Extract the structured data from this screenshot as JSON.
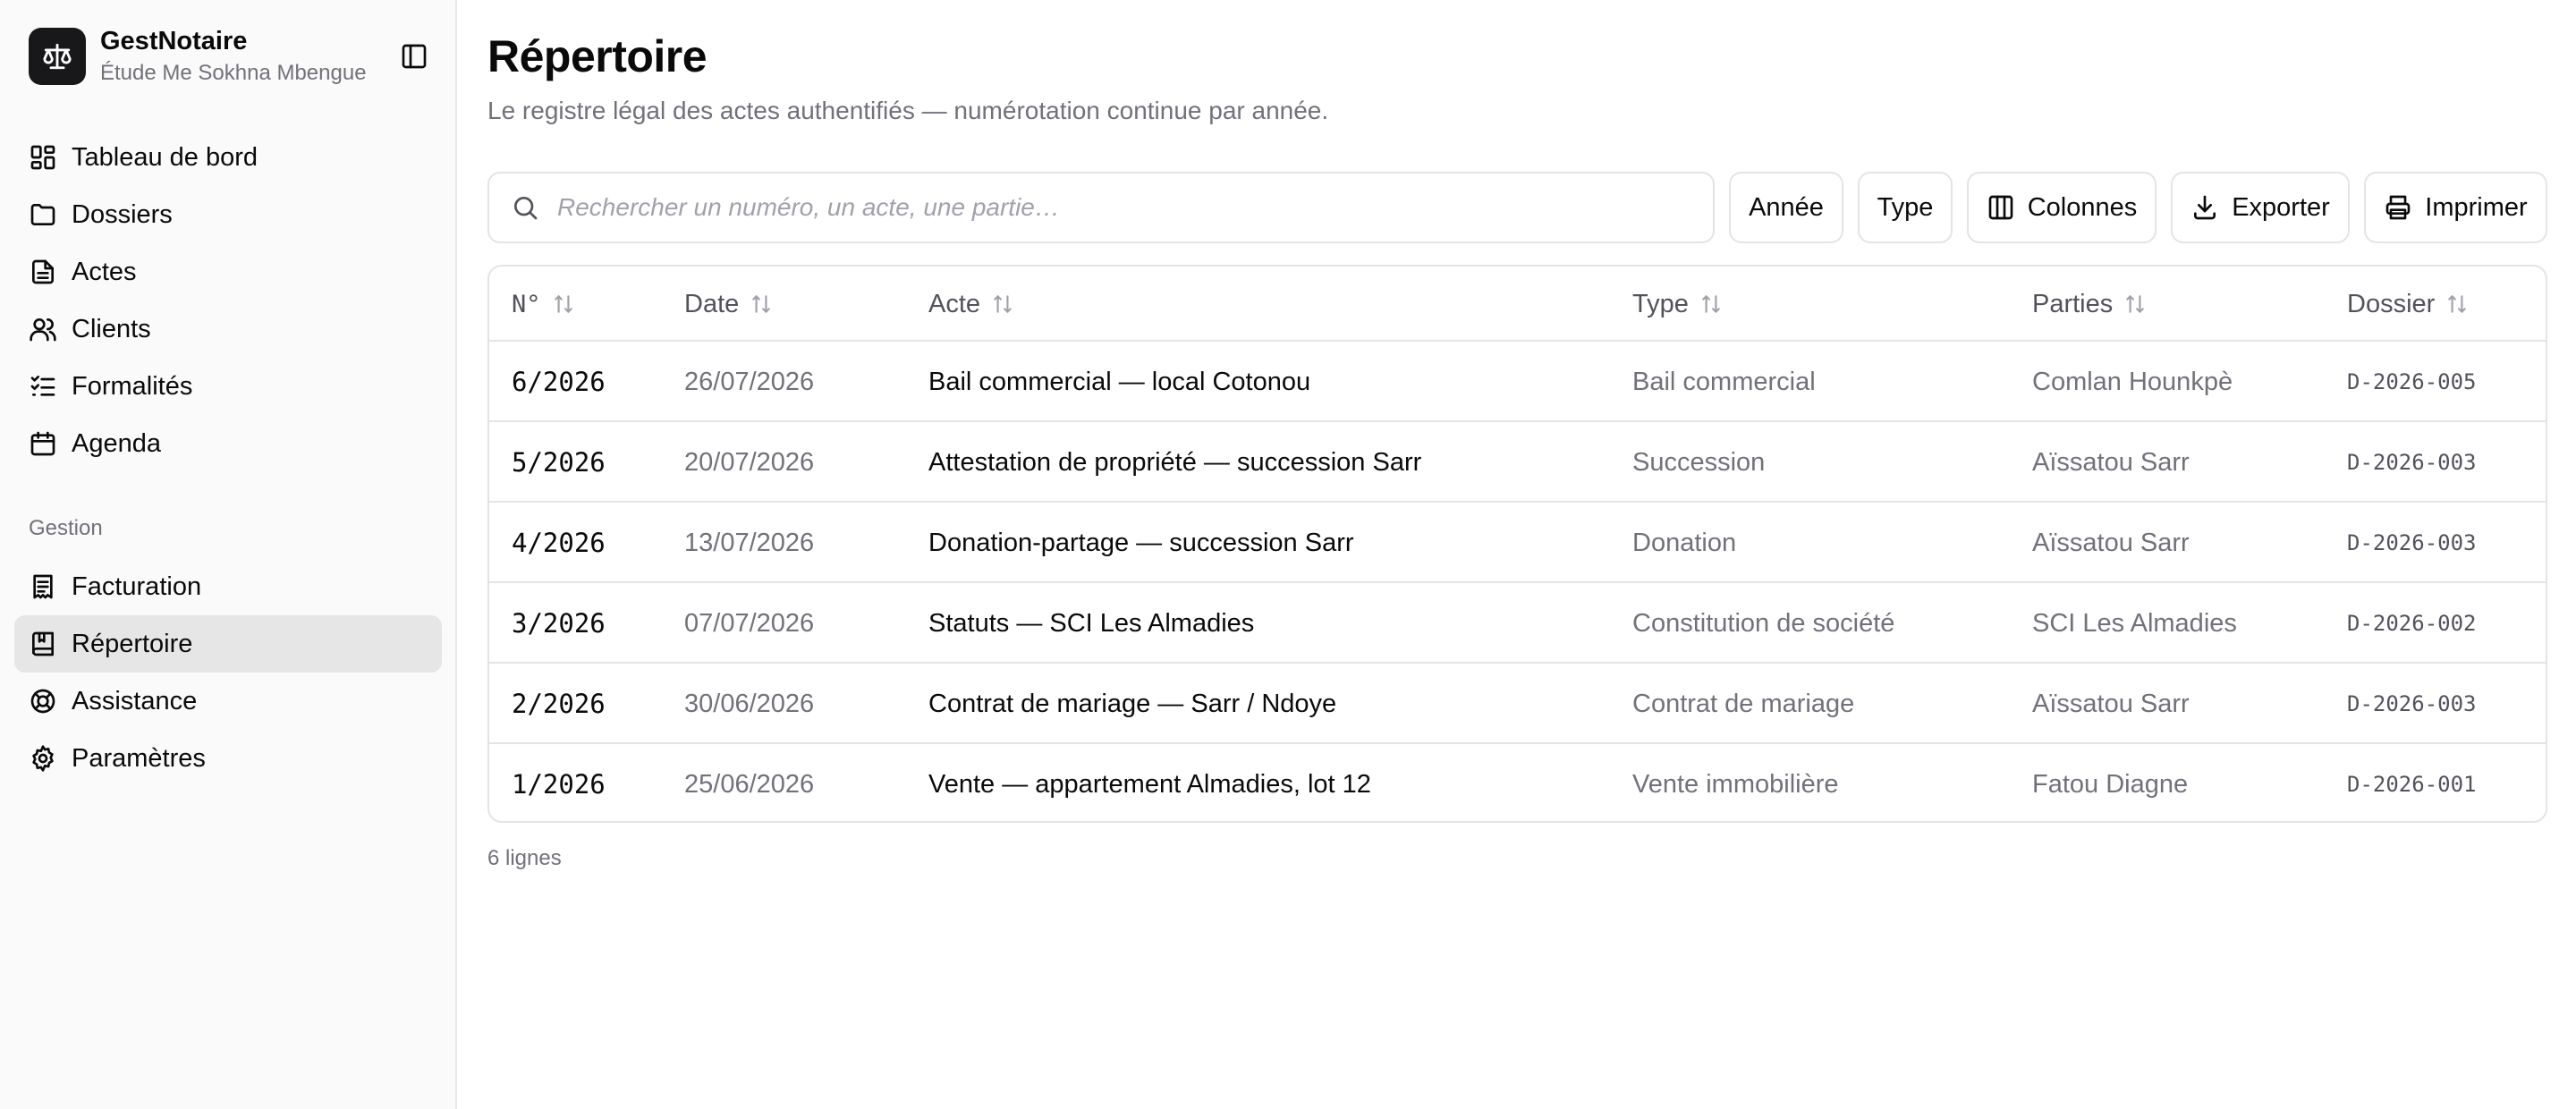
{
  "app": {
    "name": "GestNotaire",
    "office": "Étude Me Sokhna Mbengue"
  },
  "sidebar": {
    "main_items": [
      {
        "label": "Tableau de bord",
        "icon": "dashboard-icon"
      },
      {
        "label": "Dossiers",
        "icon": "folder-icon"
      },
      {
        "label": "Actes",
        "icon": "document-icon"
      },
      {
        "label": "Clients",
        "icon": "users-icon"
      },
      {
        "label": "Formalités",
        "icon": "checklist-icon"
      },
      {
        "label": "Agenda",
        "icon": "calendar-icon"
      }
    ],
    "group_label": "Gestion",
    "gestion_items": [
      {
        "label": "Facturation",
        "icon": "receipt-icon"
      },
      {
        "label": "Répertoire",
        "icon": "book-icon",
        "active": true
      },
      {
        "label": "Assistance",
        "icon": "lifebuoy-icon"
      },
      {
        "label": "Paramètres",
        "icon": "gear-icon"
      }
    ]
  },
  "page": {
    "title": "Répertoire",
    "subtitle": "Le registre légal des actes authentifiés — numérotation continue par année."
  },
  "toolbar": {
    "search_placeholder": "Rechercher un numéro, un acte, une partie…",
    "search_value": "",
    "year_label": "Année",
    "type_label": "Type",
    "columns_label": "Colonnes",
    "export_label": "Exporter",
    "print_label": "Imprimer"
  },
  "table": {
    "headers": {
      "num": "N°",
      "date": "Date",
      "acte": "Acte",
      "type": "Type",
      "parties": "Parties",
      "dossier": "Dossier"
    },
    "rows": [
      {
        "num": "6/2026",
        "date": "26/07/2026",
        "acte": "Bail commercial — local Cotonou",
        "type": "Bail commercial",
        "parties": "Comlan Hounkpè",
        "dossier": "D-2026-005"
      },
      {
        "num": "5/2026",
        "date": "20/07/2026",
        "acte": "Attestation de propriété — succession Sarr",
        "type": "Succession",
        "parties": "Aïssatou Sarr",
        "dossier": "D-2026-003"
      },
      {
        "num": "4/2026",
        "date": "13/07/2026",
        "acte": "Donation-partage — succession Sarr",
        "type": "Donation",
        "parties": "Aïssatou Sarr",
        "dossier": "D-2026-003"
      },
      {
        "num": "3/2026",
        "date": "07/07/2026",
        "acte": "Statuts — SCI Les Almadies",
        "type": "Constitution de société",
        "parties": "SCI Les Almadies",
        "dossier": "D-2026-002"
      },
      {
        "num": "2/2026",
        "date": "30/06/2026",
        "acte": "Contrat de mariage — Sarr / Ndoye",
        "type": "Contrat de mariage",
        "parties": "Aïssatou Sarr",
        "dossier": "D-2026-003"
      },
      {
        "num": "1/2026",
        "date": "25/06/2026",
        "acte": "Vente — appartement Almadies, lot 12",
        "type": "Vente immobilière",
        "parties": "Fatou Diagne",
        "dossier": "D-2026-001"
      }
    ],
    "row_count": "6 lignes"
  },
  "colors": {
    "active_nav_bg": "#e6e6e7",
    "muted_text": "#71717a",
    "border": "#e4e4e7",
    "brand_bg": "#18181b"
  }
}
